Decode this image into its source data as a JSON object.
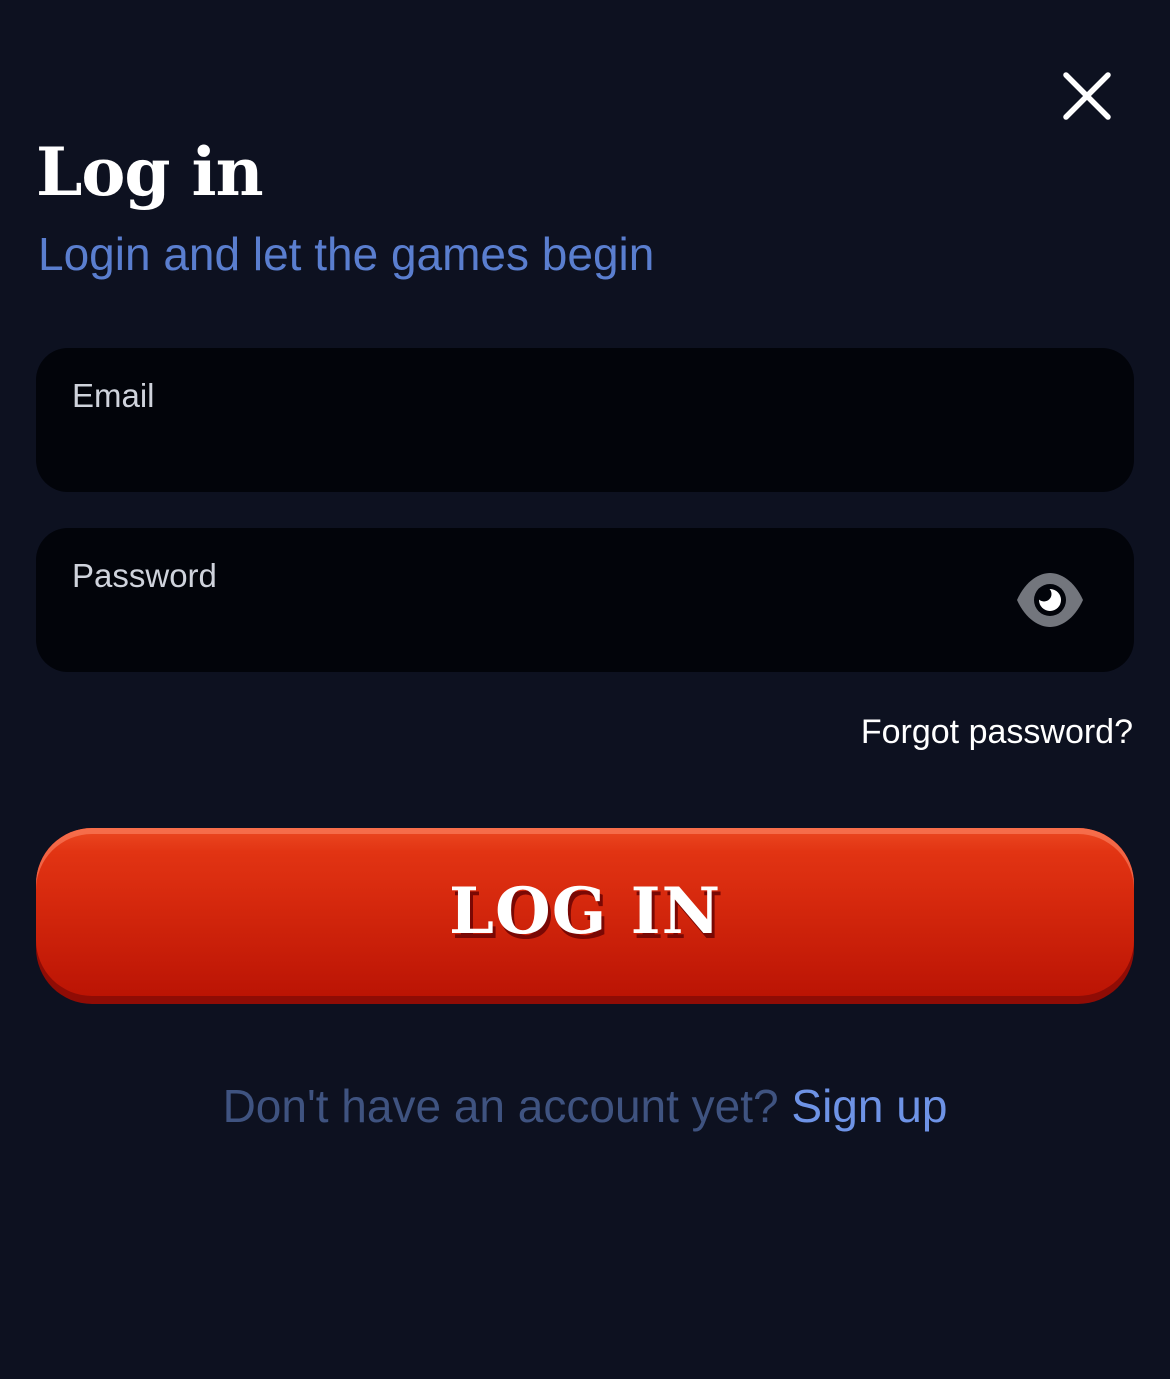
{
  "header": {
    "title": "Log in",
    "subtitle": "Login and let the games begin",
    "close_icon": "close-icon"
  },
  "form": {
    "email": {
      "label": "Email",
      "value": ""
    },
    "password": {
      "label": "Password",
      "value": "",
      "toggle_icon": "eye-icon"
    },
    "forgot_link": "Forgot password?",
    "submit_label": "LOG IN"
  },
  "footer": {
    "prompt": "Don't have an account yet?",
    "signup_link": "Sign up"
  },
  "colors": {
    "background": "#0d1120",
    "field_background": "#02040a",
    "accent_blue": "#5a7ecf",
    "button_red": "#d5280d",
    "prompt_text": "#3f5380"
  }
}
